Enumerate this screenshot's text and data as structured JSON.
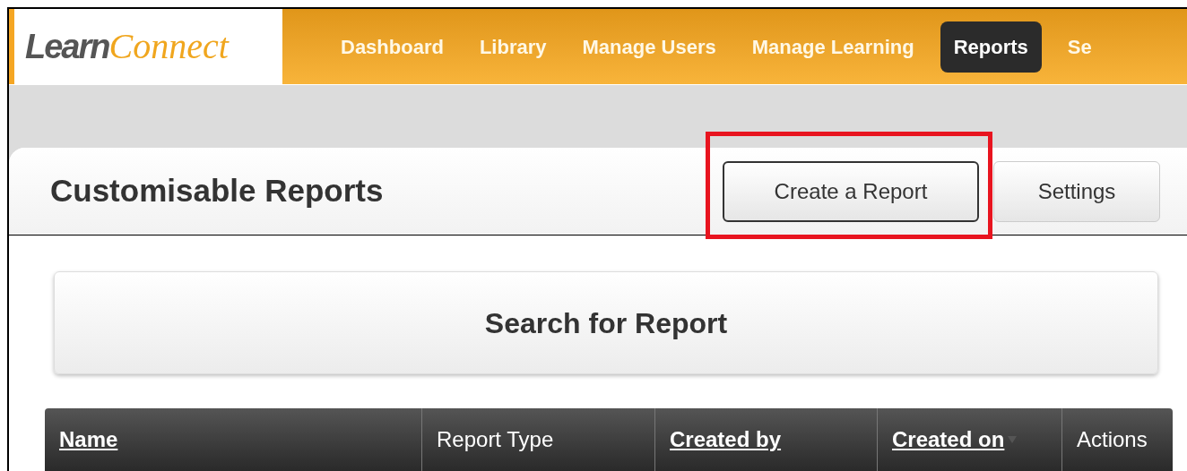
{
  "logo": {
    "part_1": "Learn",
    "part_2": "Connect"
  },
  "nav": [
    {
      "label": "Dashboard",
      "selected": false
    },
    {
      "label": "Library",
      "selected": false
    },
    {
      "label": "Manage Users",
      "selected": false
    },
    {
      "label": "Manage Learning",
      "selected": false
    },
    {
      "label": "Reports",
      "selected": true
    },
    {
      "label": "Se",
      "selected": false
    }
  ],
  "panel": {
    "title": "Customisable Reports",
    "buttons": [
      {
        "label": "Create a Report",
        "highlighted": true
      },
      {
        "label": "Settings",
        "highlighted": false
      }
    ]
  },
  "search": {
    "title": "Search for Report"
  },
  "table": {
    "columns": [
      {
        "label": "Name",
        "sortable": true,
        "sorted": false
      },
      {
        "label": "Report Type",
        "sortable": false,
        "sorted": false
      },
      {
        "label": "Created by",
        "sortable": true,
        "sorted": false
      },
      {
        "label": "Created on",
        "sortable": true,
        "sorted": true
      },
      {
        "label": "Actions",
        "sortable": false,
        "sorted": false
      }
    ]
  }
}
